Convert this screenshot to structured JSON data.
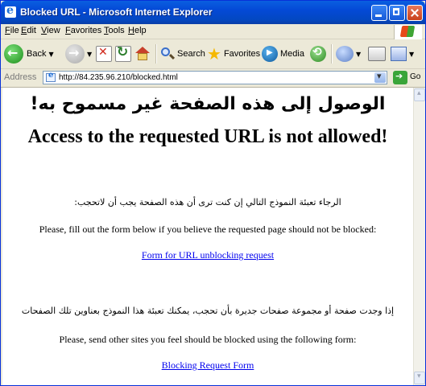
{
  "window": {
    "title": "Blocked URL - Microsoft Internet Explorer"
  },
  "menu": {
    "items": [
      "File",
      "Edit",
      "View",
      "Favorites",
      "Tools",
      "Help"
    ]
  },
  "toolbar": {
    "back": "Back",
    "search": "Search",
    "favorites": "Favorites",
    "media": "Media"
  },
  "address": {
    "label": "Address",
    "url": "http://84.235.96.210/blocked.html",
    "go": "Go"
  },
  "page": {
    "heading_ar": "الوصول إلى هذه الصفحة غير مسموح به!",
    "heading_en": "Access to the requested URL is not allowed!",
    "unblock_ar": "الرجاء تعبئة النموذج التالي إن كنت ترى أن هذه الصفحة يجب أن لاتحجب:",
    "unblock_en": "Please, fill out the form below if you believe the requested page should not be blocked:",
    "unblock_link": "Form for URL unblocking request",
    "block_ar": "إذا وجدت صفحة أو مجموعة صفحات جديرة بأن تحجب، يمكنك تعبئة هذا النموذج بعناوين تلك الصفحات",
    "block_en": "Please, send other sites you feel should be blocked using the following form:",
    "block_link": "Blocking Request Form"
  }
}
